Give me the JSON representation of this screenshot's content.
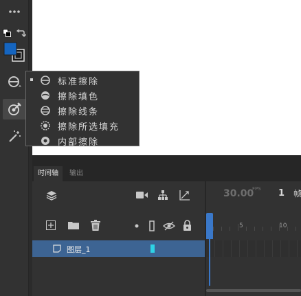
{
  "toolbar": {
    "items": [
      {
        "name": "more-tools-icon"
      },
      {
        "name": "swap-colors-icon"
      },
      {
        "name": "stroke-fill-swatch",
        "fill_color": "#1565c0"
      },
      {
        "name": "eraser-mode-icon"
      },
      {
        "name": "eyedropper-target-icon"
      },
      {
        "name": "magic-wand-icon"
      }
    ]
  },
  "eraser_menu": {
    "items": [
      {
        "label": "标准擦除",
        "selected": true,
        "icon": "eraser-normal-icon"
      },
      {
        "label": "擦除填色",
        "selected": false,
        "icon": "eraser-fill-icon"
      },
      {
        "label": "擦除线条",
        "selected": false,
        "icon": "eraser-lines-icon"
      },
      {
        "label": "擦除所选填充",
        "selected": false,
        "icon": "eraser-selected-fill-icon"
      },
      {
        "label": "内部擦除",
        "selected": false,
        "icon": "eraser-inside-icon"
      }
    ]
  },
  "timeline": {
    "tabs": [
      {
        "label": "时间轴",
        "active": true
      },
      {
        "label": "输出",
        "active": false
      }
    ],
    "fps_value": "30.00",
    "fps_unit": "FPS",
    "frame_number": "1",
    "frame_unit": "帧",
    "ruler_labels": [
      "5",
      "10"
    ],
    "layer": {
      "name": "图层_1",
      "color": "#2ed3e6"
    },
    "colors": {
      "playhead": "#3a78c9",
      "layer_selected": "#3d6493"
    }
  }
}
